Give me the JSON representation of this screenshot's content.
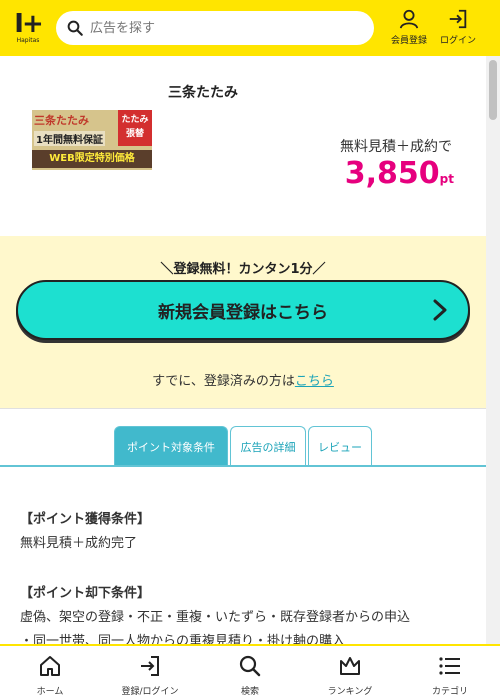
{
  "header": {
    "logo_mark": "I+",
    "logo_text": "Hapitas",
    "search_placeholder": "広告を探す",
    "register_label": "会員登録",
    "login_label": "ログイン",
    "bg_color": "#ffe500"
  },
  "ad": {
    "title": "三条たたみ",
    "banner": {
      "line1": "三条たたみ",
      "badge": "たたみ張替",
      "line2": "1年間無料保証",
      "line3": "WEB限定特別価格"
    },
    "condition_short": "無料見積＋成約で",
    "points_value": "3,850",
    "points_unit": "pt",
    "points_color": "#e6007e"
  },
  "register": {
    "tagline": "＼登録無料！カンタン1分／",
    "button_label": "新規会員登録はこちら",
    "already_text": "すでに、登録済みの方は",
    "already_link": "こちら",
    "button_color": "#1de0d0"
  },
  "tabs": [
    {
      "label": "ポイント対象条件",
      "active": true
    },
    {
      "label": "広告の詳細",
      "active": false
    },
    {
      "label": "レビュー",
      "active": false
    }
  ],
  "content": {
    "acquire_heading": "【ポイント獲得条件】",
    "acquire_text": "無料見積＋成約完了",
    "reject_heading": "【ポイント却下条件】",
    "reject_line1": "虚偽、架空の登録・不正・重複・いたずら・既存登録者からの申込",
    "reject_line2": "・同一世帯、同一人物からの重複見積り・掛け軸の購入"
  },
  "bottom_nav": [
    {
      "label": "ホーム",
      "icon": "home-icon"
    },
    {
      "label": "登録/ログイン",
      "icon": "login-icon"
    },
    {
      "label": "検索",
      "icon": "search-icon"
    },
    {
      "label": "ランキング",
      "icon": "crown-icon"
    },
    {
      "label": "カテゴリ",
      "icon": "list-icon"
    }
  ]
}
